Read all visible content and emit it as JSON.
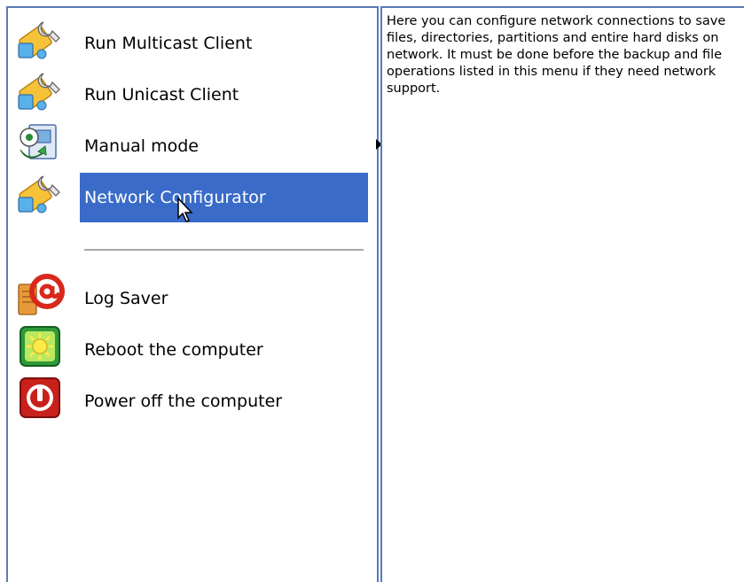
{
  "menu": {
    "items": [
      {
        "label": "Run Multicast Client",
        "icon": "network-wrench-icon"
      },
      {
        "label": "Run Unicast Client",
        "icon": "network-wrench-icon"
      },
      {
        "label": "Manual mode",
        "icon": "manual-mode-icon",
        "has_submenu": true
      },
      {
        "label": "Network Configurator",
        "icon": "network-wrench-icon",
        "selected": true
      },
      {
        "label": "Log Saver",
        "icon": "log-saver-icon"
      },
      {
        "label": "Reboot the computer",
        "icon": "reboot-icon"
      },
      {
        "label": "Power off the computer",
        "icon": "power-off-icon"
      }
    ]
  },
  "info": {
    "description": "Here you can configure network connections to save files, directories, partitions and entire hard disks on network. It must be done before the backup and file operations listed in this menu if they need network support."
  },
  "colors": {
    "panel_border": "#5a7bb5",
    "selected_bg": "#3a6bc8",
    "selected_text": "#ffffff",
    "separator": "#a8a8a8"
  }
}
